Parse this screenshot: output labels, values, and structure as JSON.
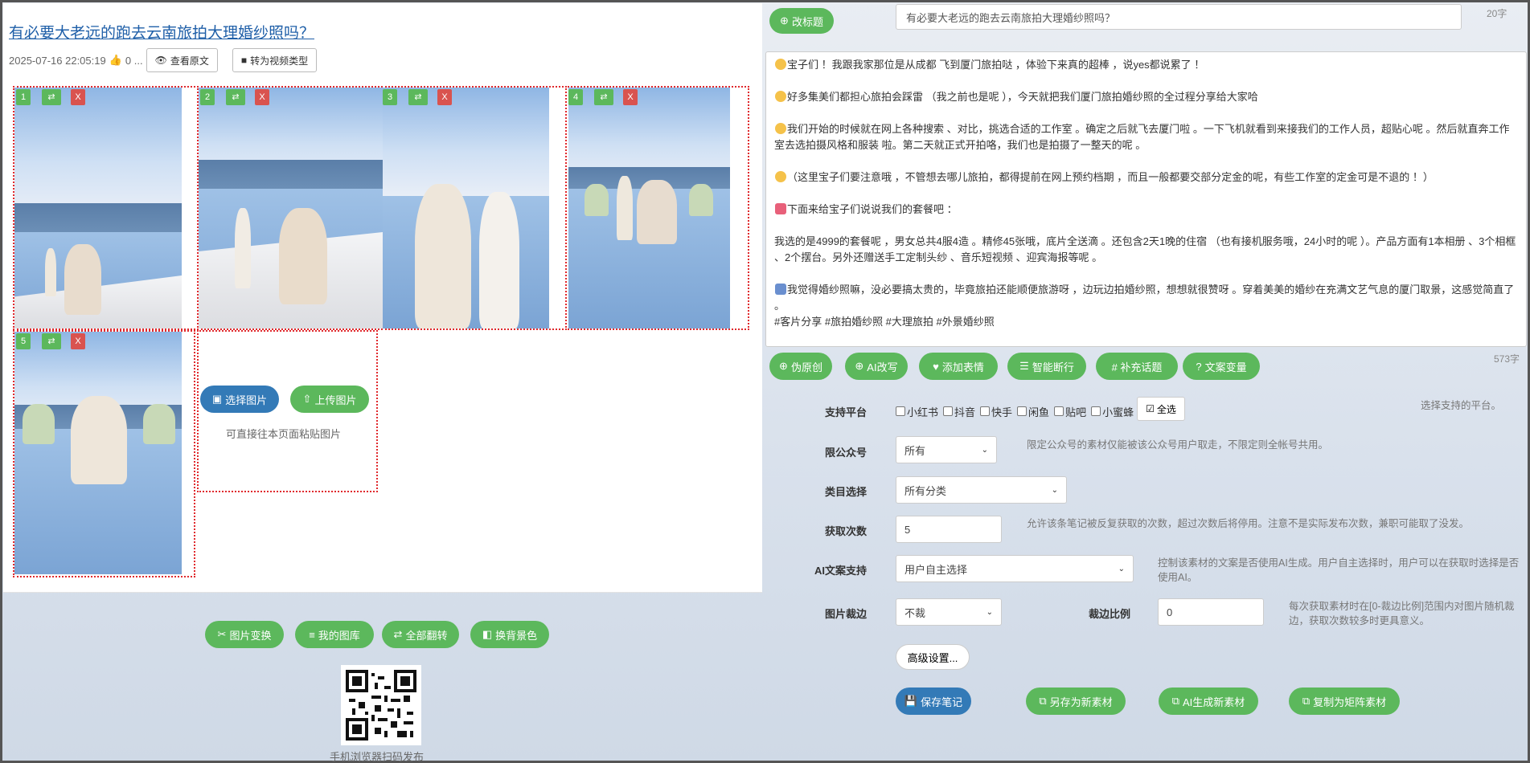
{
  "note": {
    "title": "有必要大老远的跑去云南旅拍大理婚纱照吗？",
    "datetime": "2025-07-16 22:05:19",
    "likes": "0 ...",
    "view_original": "查看原文",
    "to_video": "转为视频类型"
  },
  "images": [
    {
      "num": "1",
      "swap": "⇄",
      "del": "X"
    },
    {
      "num": "2",
      "swap": "⇄",
      "del": "X"
    },
    {
      "num": "3",
      "swap": "⇄",
      "del": "X"
    },
    {
      "num": "4",
      "swap": "⇄",
      "del": "X"
    },
    {
      "num": "5",
      "swap": "⇄",
      "del": "X"
    }
  ],
  "upload": {
    "select": "选择图片",
    "upload": "上传图片",
    "hint": "可直接往本页面粘贴图片"
  },
  "tools": {
    "transform": "图片变换",
    "gallery": "我的图库",
    "flip_all": "全部翻转",
    "bg_color": "换背景色"
  },
  "qr_caption": "手机浏览器扫码发布",
  "editor": {
    "rename": "改标题",
    "title_value": "有必要大老远的跑去云南旅拍大理婚纱照吗？",
    "title_count": "20字",
    "content_count": "573字",
    "paragraphs": [
      "宝子们 ！我跟我家那位是从成都 飞到厦门旅拍哒 ，体验下来真的超棒 ，说yes都说累了 ！",
      "好多集美们都担心旅拍会踩雷 （我之前也是呢 ），今天就把我们厦门旅拍婚纱照的全过程分享给大家哈 ",
      "我们开始的时候就在网上各种搜索 、对比，挑选合适的工作室 。确定之后就飞去厦门啦 。一下飞机就看到来接我们的工作人员，超贴心呢 。然后就直奔工作室去选拍摄风格和服装 啦。第二天就正式开拍咯，我们也是拍摄了一整天的呢 。",
      "（这里宝子们要注意哦 ，不管想去哪儿旅拍，都得提前在网上预约档期 ，而且一般都要交部分定金的呢，有些工作室的定金可是不退的 ！）",
      "下面来给宝子们说说我们的套餐吧 ：",
      "我选的是4999的套餐呢 ，男女总共4服4造 。精修45张哦，底片全送滴 。还包含2天1晚的住宿 （也有接机服务哦，24小时的呢 ）。产品方面有1本相册 、3个相框 、2个摆台。另外还赠送手工定制头纱 、音乐短视频 、迎宾海报等呢 。",
      "我觉得婚纱照嘛，没必要搞太贵的，毕竟旅拍还能顺便旅游呀 ，边玩边拍婚纱照，想想就很赞呀 。穿着美美的婚纱在充满文艺气息的厦门取景，这感觉简直了 。",
      "#客片分享 #旅拍婚纱照 #大理旅拍 #外景婚纱照"
    ],
    "actions": [
      "伪原创",
      "AI改写",
      "添加表情",
      "智能断行",
      "# 补充话题",
      "文案变量"
    ]
  },
  "form": {
    "platform_label": "支持平台",
    "platforms": [
      "小红书",
      "抖音",
      "快手",
      "闲鱼",
      "贴吧",
      "小蜜蜂"
    ],
    "select_all": "全选",
    "platform_desc": "选择支持的平台。",
    "account_label": "限公众号",
    "account_value": "所有",
    "account_desc": "限定公众号的素材仅能被该公众号用户取走，不限定则全帐号共用。",
    "category_label": "类目选择",
    "category_value": "所有分类",
    "fetch_label": "获取次数",
    "fetch_value": "5",
    "fetch_desc": "允许该条笔记被反复获取的次数，超过次数后将停用。注意不是实际发布次数，兼职可能取了没发。",
    "ai_label": "AI文案支持",
    "ai_value": "用户自主选择",
    "ai_desc": "控制该素材的文案是否使用AI生成。用户自主选择时，用户可以在获取时选择是否使用AI。",
    "crop_label": "图片裁边",
    "crop_value": "不裁",
    "ratio_label": "裁边比例",
    "ratio_value": "0",
    "ratio_desc": "每次获取素材时在[0-裁边比例]范围内对图片随机裁边，获取次数较多时更具意义。",
    "advanced": "高级设置..."
  },
  "save": {
    "save_note": "保存笔记",
    "save_as_new": "另存为新素材",
    "ai_new": "AI生成新素材",
    "copy_matrix": "复制为矩阵素材"
  },
  "colors": {
    "green": "#5cb85c",
    "blue": "#337ab7",
    "red": "#d9534f",
    "link": "#1f5fa8"
  }
}
